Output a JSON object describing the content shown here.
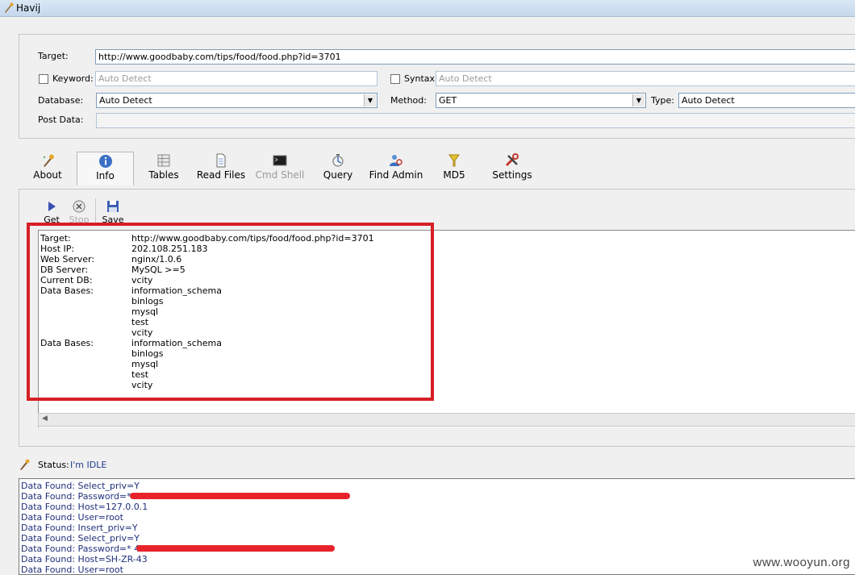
{
  "window": {
    "title": "Havij"
  },
  "form": {
    "target_label": "Target:",
    "target_value": "http://www.goodbaby.com/tips/food/food.php?id=3701",
    "keyword_label": "Keyword:",
    "keyword_value": "Auto Detect",
    "syntax_label": "Syntax:",
    "syntax_value": "Auto Detect",
    "database_label": "Database:",
    "database_value": "Auto Detect",
    "method_label": "Method:",
    "method_value": "GET",
    "type_label": "Type:",
    "type_value": "Auto Detect",
    "postdata_label": "Post Data:",
    "postdata_value": ""
  },
  "toolbar": [
    {
      "label": "About",
      "icon": "about-icon",
      "state": "normal"
    },
    {
      "label": "Info",
      "icon": "info-icon",
      "state": "active"
    },
    {
      "label": "Tables",
      "icon": "tables-icon",
      "state": "normal"
    },
    {
      "label": "Read Files",
      "icon": "read-files-icon",
      "state": "normal"
    },
    {
      "label": "Cmd Shell",
      "icon": "cmd-shell-icon",
      "state": "disabled"
    },
    {
      "label": "Query",
      "icon": "query-icon",
      "state": "normal"
    },
    {
      "label": "Find Admin",
      "icon": "find-admin-icon",
      "state": "normal"
    },
    {
      "label": "MD5",
      "icon": "md5-icon",
      "state": "normal"
    },
    {
      "label": "Settings",
      "icon": "settings-icon",
      "state": "normal"
    }
  ],
  "info_toolbar": {
    "get_label": "Get",
    "stop_label": "Stop",
    "save_label": "Save"
  },
  "info": {
    "rows": [
      {
        "key": "Target:",
        "value": "http://www.goodbaby.com/tips/food/food.php?id=3701"
      },
      {
        "key": "Host IP:",
        "value": "202.108.251.183"
      },
      {
        "key": "Web Server:",
        "value": "nginx/1.0.6"
      },
      {
        "key": "DB Server:",
        "value": "MySQL >=5"
      },
      {
        "key": "Current DB:",
        "value": "vcity"
      },
      {
        "key": "Data Bases:",
        "value": "information_schema"
      },
      {
        "key": "",
        "value": "binlogs"
      },
      {
        "key": "",
        "value": "mysql"
      },
      {
        "key": "",
        "value": "test"
      },
      {
        "key": "",
        "value": "vcity"
      },
      {
        "key": "Data Bases:",
        "value": "information_schema"
      },
      {
        "key": "",
        "value": "binlogs"
      },
      {
        "key": "",
        "value": "mysql"
      },
      {
        "key": "",
        "value": "test"
      },
      {
        "key": "",
        "value": "vcity"
      }
    ]
  },
  "status": {
    "label": "Status:",
    "value": "I'm IDLE"
  },
  "log": [
    "Data Found: Select_priv=Y",
    "Data Found: Password=*                                       1AABF",
    "Data Found: Host=127.0.0.1",
    "Data Found: User=root",
    "Data Found: Insert_priv=Y",
    "Data Found: Select_priv=Y",
    "Data Found: Password=*                                       401AABF",
    "Data Found: Host=SH-ZR-43",
    "Data Found: User=root"
  ],
  "watermark": "www.wooyun.org",
  "colors": {
    "highlight_box": "#d61f26",
    "redaction": "#e8232b",
    "log_text": "#1f2f7a"
  }
}
